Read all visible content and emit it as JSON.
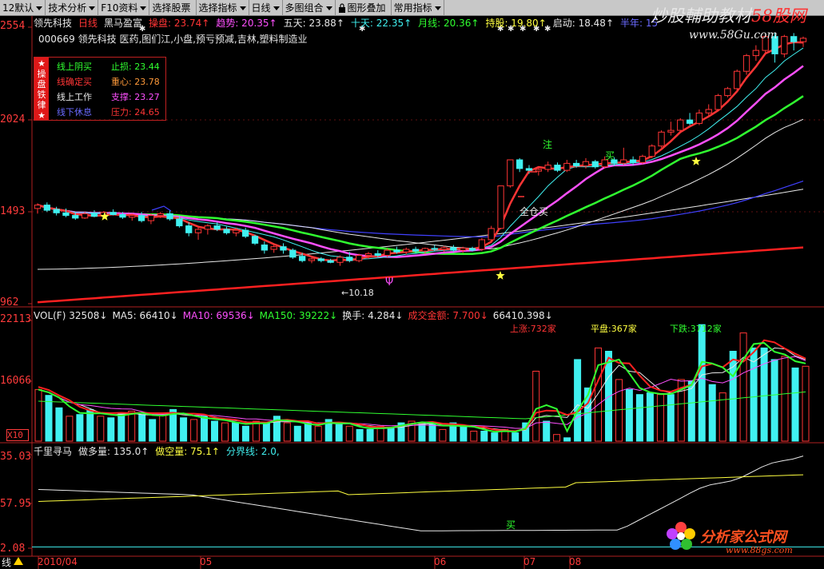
{
  "toolbar": {
    "items": [
      {
        "label": "12默认",
        "arrow": true
      },
      {
        "label": "技术分析",
        "arrow": true
      },
      {
        "label": "F10资料",
        "arrow": true
      },
      {
        "label": "选择股票",
        "arrow": false
      },
      {
        "label": "选择指标",
        "arrow": true
      },
      {
        "label": "日线",
        "arrow": true
      },
      {
        "label": "多图组合",
        "arrow": true
      },
      {
        "label": "图形叠加",
        "arrow": false
      },
      {
        "label": "常用指标",
        "arrow": true
      }
    ]
  },
  "watermark": {
    "top_text": "炒股輔助教材",
    "top_brand": "58股网",
    "top_url": "www.58Gu.com",
    "bottom_text": "分析家公式网",
    "bottom_url": "www.88gs.com"
  },
  "main_chart": {
    "title_segments": [
      {
        "text": "领先科技",
        "color": "white"
      },
      {
        "text": "日线",
        "color": "red"
      },
      {
        "text": "黑马盈富",
        "color": "white"
      },
      {
        "text": "操盘: 23.74↑",
        "color": "red"
      },
      {
        "text": "趋势: 20.35↑",
        "color": "magenta"
      },
      {
        "text": "五天: 23.88↑",
        "color": "white"
      },
      {
        "text": "十天: 22.35↑",
        "color": "cyan"
      },
      {
        "text": "月线: 20.36↑",
        "color": "green"
      },
      {
        "text": "持股: 19.80↑",
        "color": "yellow"
      },
      {
        "text": "启动: 18.48↑",
        "color": "white"
      },
      {
        "text": "半年: 15",
        "color": "blue"
      }
    ],
    "subtitle": "000669 领先科技 医药,图们江,小盘,预亏预减,吉林,塑料制造业",
    "y_labels": [
      "2554",
      "2024",
      "1493",
      "962"
    ],
    "infobox": {
      "side_text": "★\n操\n盘\n铁\n律\n★",
      "rows": [
        {
          "left": "线上阴买",
          "right": "止损: 23.44",
          "left_color": "green",
          "right_color": "green"
        },
        {
          "left": "线确定买",
          "right": "重心: 23.78",
          "left_color": "red",
          "right_color": "orange"
        },
        {
          "left": "线上工作",
          "right": "支撑: 23.27",
          "left_color": "white",
          "right_color": "magenta"
        },
        {
          "left": "线下休息",
          "right": "压力: 24.65",
          "left_color": "blue",
          "right_color": "red"
        }
      ]
    },
    "annotations": {
      "low_price": "←10.18",
      "buy_all": "全仓买",
      "zhu": "注",
      "mai": "买"
    },
    "candles": [
      {
        "o": 1510,
        "h": 1540,
        "l": 1480,
        "c": 1530
      },
      {
        "o": 1530,
        "h": 1545,
        "l": 1490,
        "c": 1500
      },
      {
        "o": 1505,
        "h": 1520,
        "l": 1470,
        "c": 1485
      },
      {
        "o": 1485,
        "h": 1510,
        "l": 1460,
        "c": 1470
      },
      {
        "o": 1470,
        "h": 1490,
        "l": 1445,
        "c": 1455
      },
      {
        "o": 1455,
        "h": 1490,
        "l": 1450,
        "c": 1480
      },
      {
        "o": 1480,
        "h": 1500,
        "l": 1460,
        "c": 1465
      },
      {
        "o": 1465,
        "h": 1495,
        "l": 1455,
        "c": 1488
      },
      {
        "o": 1488,
        "h": 1505,
        "l": 1470,
        "c": 1475
      },
      {
        "o": 1475,
        "h": 1490,
        "l": 1450,
        "c": 1460
      },
      {
        "o": 1460,
        "h": 1480,
        "l": 1440,
        "c": 1470
      },
      {
        "o": 1470,
        "h": 1490,
        "l": 1430,
        "c": 1440
      },
      {
        "o": 1440,
        "h": 1480,
        "l": 1420,
        "c": 1470
      },
      {
        "o": 1470,
        "h": 1490,
        "l": 1455,
        "c": 1480
      },
      {
        "o": 1480,
        "h": 1500,
        "l": 1440,
        "c": 1450
      },
      {
        "o": 1450,
        "h": 1470,
        "l": 1400,
        "c": 1410
      },
      {
        "o": 1410,
        "h": 1430,
        "l": 1350,
        "c": 1370
      },
      {
        "o": 1370,
        "h": 1400,
        "l": 1330,
        "c": 1390
      },
      {
        "o": 1390,
        "h": 1420,
        "l": 1360,
        "c": 1410
      },
      {
        "o": 1410,
        "h": 1430,
        "l": 1380,
        "c": 1390
      },
      {
        "o": 1390,
        "h": 1405,
        "l": 1360,
        "c": 1370
      },
      {
        "o": 1370,
        "h": 1400,
        "l": 1350,
        "c": 1385
      },
      {
        "o": 1385,
        "h": 1400,
        "l": 1340,
        "c": 1350
      },
      {
        "o": 1350,
        "h": 1360,
        "l": 1300,
        "c": 1310
      },
      {
        "o": 1300,
        "h": 1320,
        "l": 1250,
        "c": 1270
      },
      {
        "o": 1275,
        "h": 1300,
        "l": 1255,
        "c": 1290
      },
      {
        "o": 1290,
        "h": 1310,
        "l": 1250,
        "c": 1270
      },
      {
        "o": 1270,
        "h": 1280,
        "l": 1220,
        "c": 1230
      },
      {
        "o": 1235,
        "h": 1255,
        "l": 1200,
        "c": 1210
      },
      {
        "o": 1210,
        "h": 1230,
        "l": 1195,
        "c": 1220
      },
      {
        "o": 1220,
        "h": 1230,
        "l": 1200,
        "c": 1210
      },
      {
        "o": 1210,
        "h": 1220,
        "l": 1195,
        "c": 1200
      },
      {
        "o": 1200,
        "h": 1240,
        "l": 1180,
        "c": 1230
      },
      {
        "o": 1230,
        "h": 1260,
        "l": 1200,
        "c": 1210
      },
      {
        "o": 1210,
        "h": 1250,
        "l": 1200,
        "c": 1240
      },
      {
        "o": 1240,
        "h": 1260,
        "l": 1220,
        "c": 1250
      },
      {
        "o": 1250,
        "h": 1270,
        "l": 1230,
        "c": 1240
      },
      {
        "o": 1240,
        "h": 1280,
        "l": 1230,
        "c": 1270
      },
      {
        "o": 1270,
        "h": 1290,
        "l": 1250,
        "c": 1260
      },
      {
        "o": 1260,
        "h": 1285,
        "l": 1245,
        "c": 1275
      },
      {
        "o": 1275,
        "h": 1290,
        "l": 1255,
        "c": 1265
      },
      {
        "o": 1265,
        "h": 1285,
        "l": 1250,
        "c": 1280
      },
      {
        "o": 1280,
        "h": 1300,
        "l": 1265,
        "c": 1275
      },
      {
        "o": 1275,
        "h": 1295,
        "l": 1260,
        "c": 1285
      },
      {
        "o": 1285,
        "h": 1300,
        "l": 1260,
        "c": 1270
      },
      {
        "o": 1270,
        "h": 1290,
        "l": 1255,
        "c": 1282
      },
      {
        "o": 1280,
        "h": 1290,
        "l": 1262,
        "c": 1270
      },
      {
        "o": 1275,
        "h": 1340,
        "l": 1265,
        "c": 1330
      },
      {
        "o": 1330,
        "h": 1410,
        "l": 1320,
        "c": 1395
      },
      {
        "o": 1395,
        "h": 1640,
        "l": 1390,
        "c": 1640
      },
      {
        "o": 1640,
        "h": 1790,
        "l": 1630,
        "c": 1790
      },
      {
        "o": 1790,
        "h": 1800,
        "l": 1720,
        "c": 1740
      },
      {
        "o": 1740,
        "h": 1760,
        "l": 1710,
        "c": 1730
      },
      {
        "o": 1725,
        "h": 1745,
        "l": 1700,
        "c": 1735
      },
      {
        "o": 1735,
        "h": 1780,
        "l": 1720,
        "c": 1760
      },
      {
        "o": 1760,
        "h": 1775,
        "l": 1720,
        "c": 1730
      },
      {
        "o": 1730,
        "h": 1790,
        "l": 1720,
        "c": 1770
      },
      {
        "o": 1770,
        "h": 1790,
        "l": 1745,
        "c": 1755
      },
      {
        "o": 1755,
        "h": 1800,
        "l": 1740,
        "c": 1780
      },
      {
        "o": 1780,
        "h": 1790,
        "l": 1740,
        "c": 1750
      },
      {
        "o": 1750,
        "h": 1810,
        "l": 1740,
        "c": 1790
      },
      {
        "o": 1790,
        "h": 1805,
        "l": 1755,
        "c": 1770
      },
      {
        "o": 1770,
        "h": 1860,
        "l": 1760,
        "c": 1790
      },
      {
        "o": 1790,
        "h": 1810,
        "l": 1760,
        "c": 1775
      },
      {
        "o": 1775,
        "h": 1820,
        "l": 1765,
        "c": 1810
      },
      {
        "o": 1810,
        "h": 1880,
        "l": 1800,
        "c": 1870
      },
      {
        "o": 1870,
        "h": 1960,
        "l": 1860,
        "c": 1950
      },
      {
        "o": 1950,
        "h": 2010,
        "l": 1930,
        "c": 1960
      },
      {
        "o": 1960,
        "h": 2030,
        "l": 1950,
        "c": 2020
      },
      {
        "o": 2020,
        "h": 2060,
        "l": 1990,
        "c": 2000
      },
      {
        "o": 2000,
        "h": 2080,
        "l": 1990,
        "c": 2060
      },
      {
        "o": 2060,
        "h": 2110,
        "l": 2040,
        "c": 2080
      },
      {
        "o": 2080,
        "h": 2170,
        "l": 2070,
        "c": 2160
      },
      {
        "o": 2160,
        "h": 2210,
        "l": 2150,
        "c": 2200
      },
      {
        "o": 2200,
        "h": 2310,
        "l": 2180,
        "c": 2300
      },
      {
        "o": 2300,
        "h": 2400,
        "l": 2280,
        "c": 2390
      },
      {
        "o": 2390,
        "h": 2450,
        "l": 2360,
        "c": 2420
      },
      {
        "o": 2420,
        "h": 2510,
        "l": 2400,
        "c": 2500
      },
      {
        "o": 2500,
        "h": 2520,
        "l": 2350,
        "c": 2400
      },
      {
        "o": 2400,
        "h": 2510,
        "l": 2380,
        "c": 2500
      },
      {
        "o": 2500,
        "h": 2520,
        "l": 2420,
        "c": 2470
      },
      {
        "o": 2470,
        "h": 2500,
        "l": 2440,
        "c": 2490
      }
    ]
  },
  "vol_panel": {
    "title_segments": [
      {
        "text": "VOL(F) 32508↓",
        "color": "white"
      },
      {
        "text": "MA5: 66410↓",
        "color": "white"
      },
      {
        "text": "MA10: 69536↓",
        "color": "magenta"
      },
      {
        "text": "MA150: 39222↓",
        "color": "green"
      },
      {
        "text": "换手: 4.284↓",
        "color": "white"
      },
      {
        "text": "成交金额: 7.700↓",
        "color": "red"
      },
      {
        "text": "66410.398↓",
        "color": "white"
      }
    ],
    "market_stats": [
      {
        "text": "上涨:732家",
        "color": "red"
      },
      {
        "text": "平盘:367家",
        "color": "yellow"
      },
      {
        "text": "下跌:3712家",
        "color": "green"
      }
    ],
    "y_labels": [
      "22113",
      "16066",
      "X10"
    ],
    "volumes": [
      62,
      55,
      40,
      30,
      32,
      38,
      30,
      28,
      34,
      36,
      32,
      26,
      34,
      38,
      28,
      26,
      30,
      24,
      22,
      22,
      18,
      24,
      22,
      30,
      22,
      18,
      22,
      18,
      26,
      20,
      18,
      14,
      14,
      18,
      16,
      22,
      24,
      22,
      20,
      14,
      22,
      18,
      12,
      12,
      10,
      14,
      10,
      22,
      84,
      24,
      8,
      4,
      98,
      64,
      112,
      108,
      74,
      62,
      56,
      58,
      56,
      56,
      74,
      72,
      140,
      68,
      58,
      108,
      130,
      112,
      112,
      98,
      102,
      88,
      90
    ]
  },
  "ind_panel": {
    "title_segments": [
      {
        "text": "千里寻马",
        "color": "white"
      },
      {
        "text": "做多量: 135.0↑",
        "color": "white"
      },
      {
        "text": "做空量: 75.1↑",
        "color": "yellow"
      },
      {
        "text": "分界线: 2.0,",
        "color": "cyan"
      }
    ],
    "y_labels": [
      "35.03",
      "57.95",
      "2.08"
    ],
    "bottom_left": "线",
    "annotation": "买"
  },
  "date_axis": {
    "labels": [
      "2010/04",
      "05",
      "06",
      "07",
      "08"
    ]
  }
}
